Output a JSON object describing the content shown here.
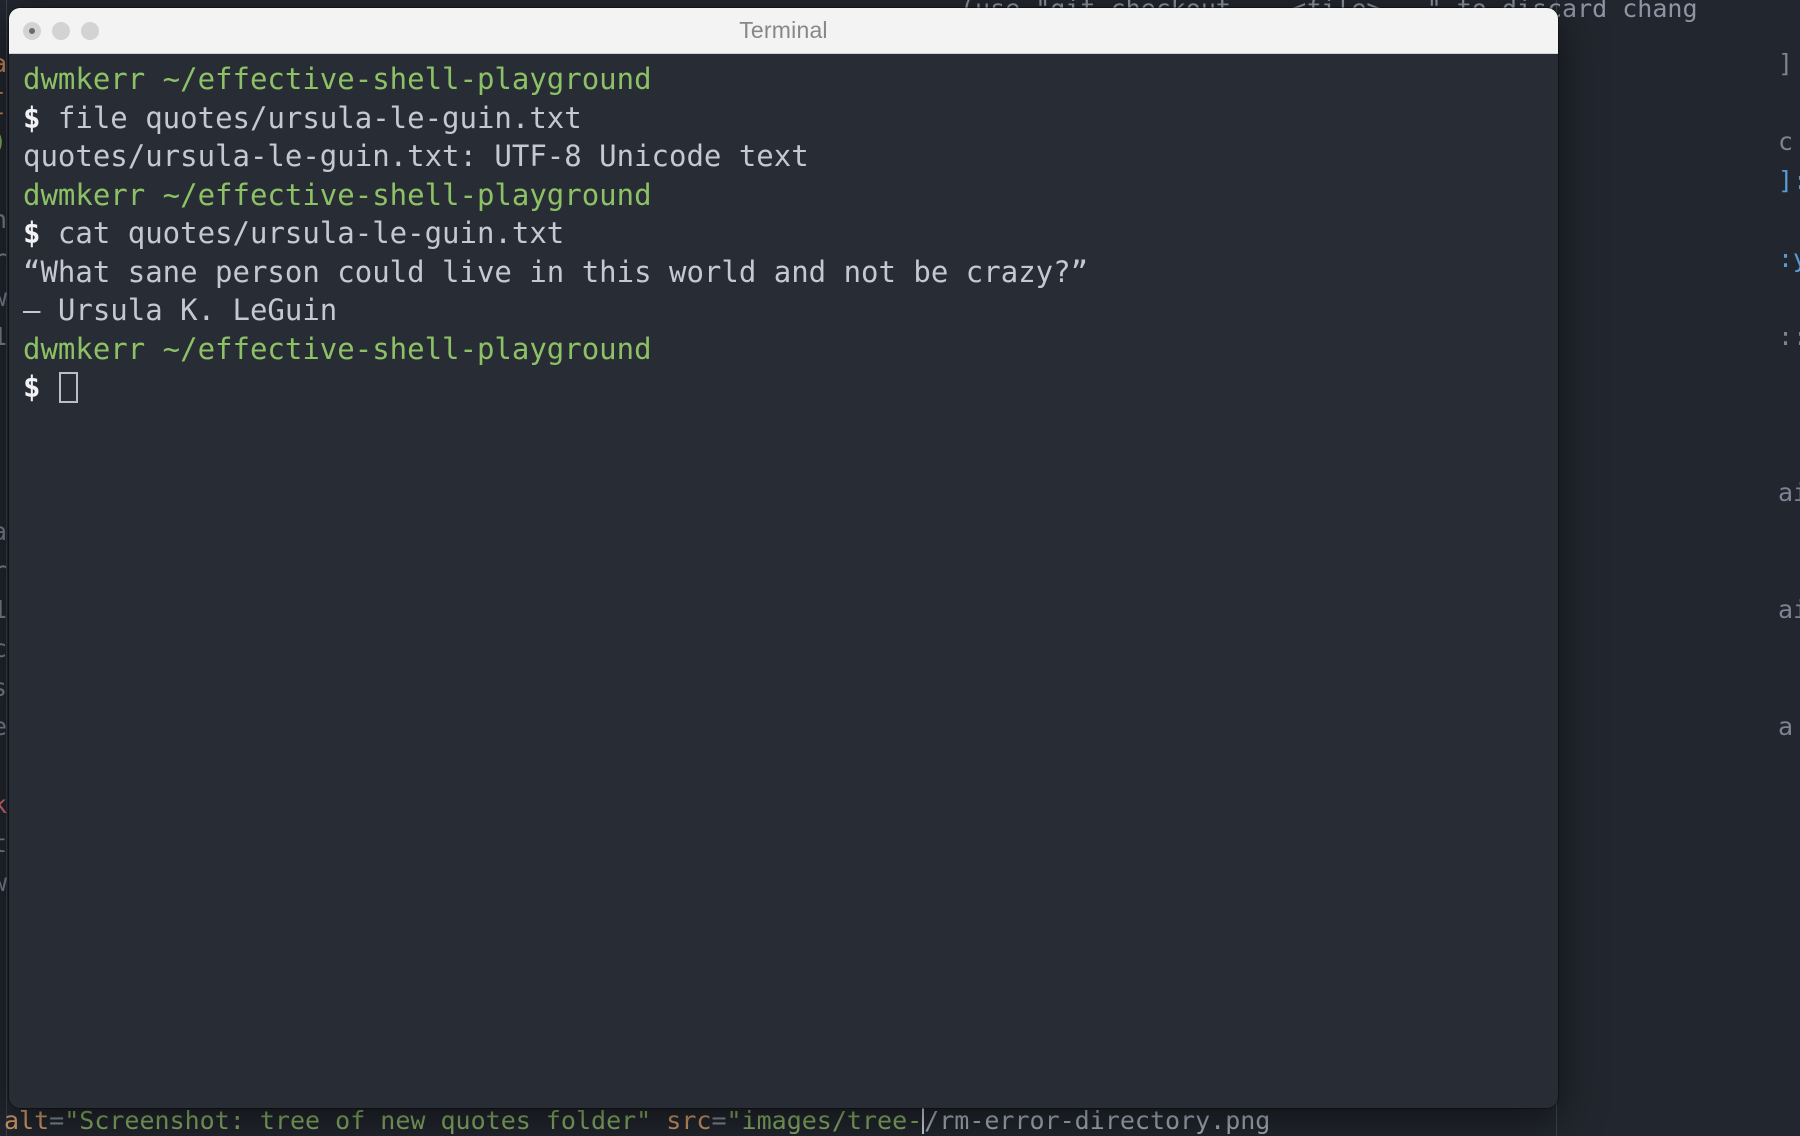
{
  "background": {
    "top_line": "(use \"git checkout -- <file>...\" to discard chang",
    "bottom_line": {
      "attr1": "alt",
      "eq": "=",
      "str1": "\"Screenshot: tree of new quotes folder\"",
      "attr2": "src",
      "str2": "\"images/tree-",
      "after_caret": "/rm-error-directory.png"
    },
    "left_fragments": [
      "a",
      "[",
      ")",
      "",
      "n",
      "rc",
      "w",
      "1c",
      "",
      "",
      "",
      "",
      "a",
      "ri",
      "1",
      "c",
      "s",
      "e",
      "",
      "k",
      "t",
      "w"
    ],
    "right_fragments": [
      "]",
      "",
      "c",
      "]:y",
      "",
      ":y",
      "",
      "::",
      "",
      "",
      "",
      "ai",
      "",
      "",
      "ai",
      "",
      "",
      "a"
    ]
  },
  "window": {
    "title": "Terminal",
    "controls": {
      "close": "close-button",
      "minimize": "minimize-button",
      "zoom": "zoom-button"
    }
  },
  "terminal": {
    "lines": [
      {
        "type": "prompt",
        "text": "dwmkerr ~/effective-shell-playground"
      },
      {
        "type": "command",
        "sigil": "$",
        "text": " file quotes/ursula-le-guin.txt"
      },
      {
        "type": "output",
        "text": "quotes/ursula-le-guin.txt: UTF-8 Unicode text"
      },
      {
        "type": "prompt",
        "text": "dwmkerr ~/effective-shell-playground"
      },
      {
        "type": "command",
        "sigil": "$",
        "text": " cat quotes/ursula-le-guin.txt"
      },
      {
        "type": "output",
        "text": "“What sane person could live in this world and not be crazy?”"
      },
      {
        "type": "output",
        "text": "— Ursula K. LeGuin"
      },
      {
        "type": "prompt",
        "text": "dwmkerr ~/effective-shell-playground"
      },
      {
        "type": "cursor",
        "sigil": "$",
        "text": " "
      }
    ]
  },
  "colors": {
    "terminal_background": "#282c34",
    "desktop_background": "#22262e",
    "prompt_green": "#8cc265",
    "output_gray": "#c3c9d3",
    "titlebar": "#f3f3f3",
    "title_text": "#878787"
  }
}
